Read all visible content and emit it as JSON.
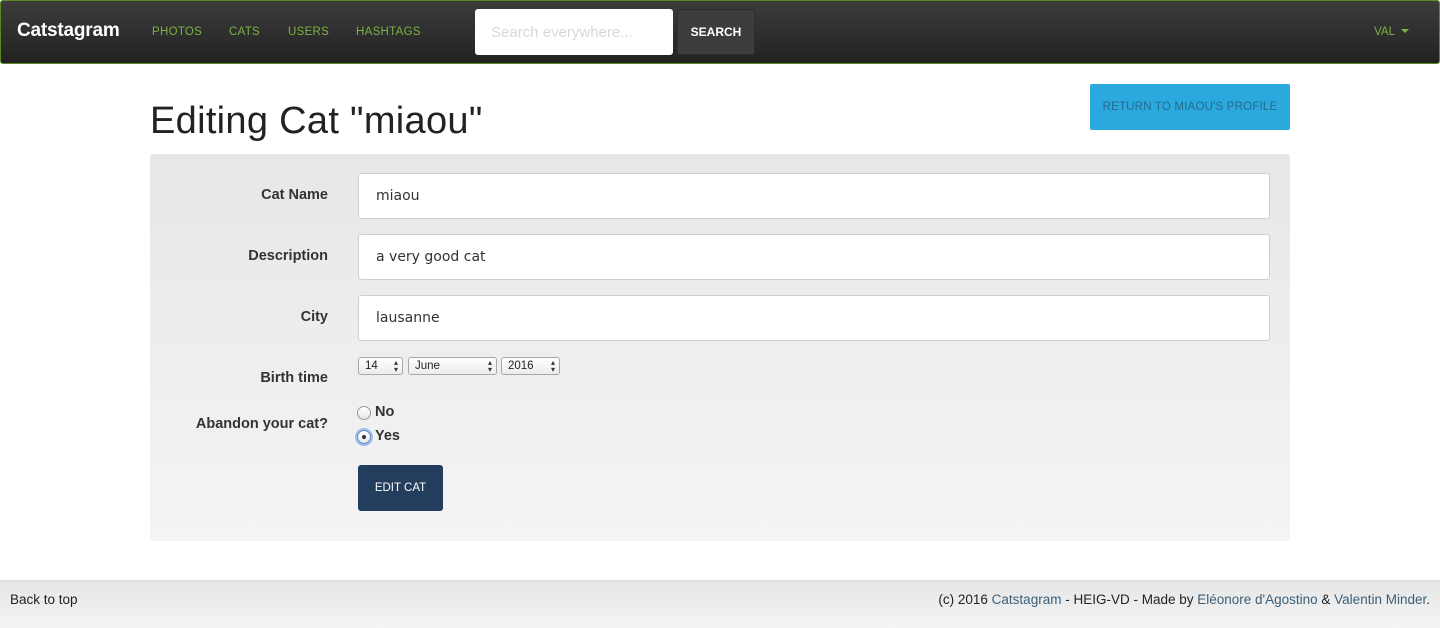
{
  "navbar": {
    "brand": "Catstagram",
    "links": [
      "PHOTOS",
      "CATS",
      "USERS",
      "HASHTAGS"
    ],
    "search": {
      "placeholder": "Search everywhere...",
      "button": "SEARCH"
    },
    "user": "VAL"
  },
  "header": {
    "title": "Editing Cat \"miaou\"",
    "return_button": "RETURN TO MIAOU'S PROFILE"
  },
  "form": {
    "cat_name": {
      "label": "Cat Name",
      "value": "miaou"
    },
    "description": {
      "label": "Description",
      "value": "a very good cat"
    },
    "city": {
      "label": "City",
      "value": "lausanne"
    },
    "birth_time": {
      "label": "Birth time",
      "day": "14",
      "month": "June",
      "year": "2016"
    },
    "abandon": {
      "label": "Abandon your cat?",
      "options": [
        "No",
        "Yes"
      ],
      "selected": "Yes"
    },
    "submit": "EDIT CAT"
  },
  "footer": {
    "back_to_top": "Back to top",
    "credits": {
      "prefix": "(c) 2016 ",
      "site": "Catstagram",
      "middle": " - HEIG-VD - Made by ",
      "author1": "Eléonore d'Agostino",
      "sep": " & ",
      "author2": "Valentin Minder",
      "suffix": "."
    }
  },
  "colors": {
    "nav_accent": "#7cb342",
    "return_button": "#2ba8de",
    "submit_button": "#233d5c"
  }
}
